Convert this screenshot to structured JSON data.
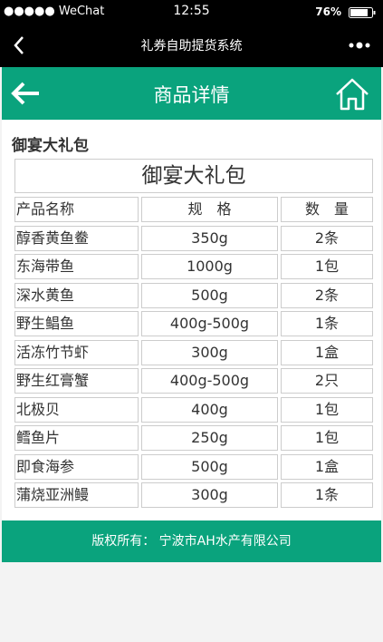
{
  "status_bar": {
    "carrier": "●●●●● WeChat",
    "time": "12:55",
    "battery": "76%"
  },
  "wechat_bar": {
    "title": "礼券自助提货系统"
  },
  "header": {
    "title": "商品详情"
  },
  "section": {
    "title": "御宴大礼包"
  },
  "package": {
    "title": "御宴大礼包",
    "headers": {
      "name": "产品名称",
      "spec": "规　格",
      "qty": "数　量"
    },
    "items": [
      {
        "name": "醇香黄鱼鲞",
        "spec": "350g",
        "qty": "2条"
      },
      {
        "name": "东海带鱼",
        "spec": "1000g",
        "qty": "1包"
      },
      {
        "name": "深水黄鱼",
        "spec": "500g",
        "qty": "2条"
      },
      {
        "name": "野生鲳鱼",
        "spec": "400g-500g",
        "qty": "1条"
      },
      {
        "name": "活冻竹节虾",
        "spec": "300g",
        "qty": "1盒"
      },
      {
        "name": "野生红膏蟹",
        "spec": "400g-500g",
        "qty": "2只"
      },
      {
        "name": "北极贝",
        "spec": "400g",
        "qty": "1包"
      },
      {
        "name": "鳕鱼片",
        "spec": "250g",
        "qty": "1包"
      },
      {
        "name": "即食海参",
        "spec": "500g",
        "qty": "1盒"
      },
      {
        "name": "蒲烧亚洲鳗",
        "spec": "300g",
        "qty": "1条"
      }
    ]
  },
  "footer": {
    "text": "版权所有：  宁波市AH水产有限公司"
  },
  "colors": {
    "brand": "#0aa37d",
    "bar": "#000000"
  }
}
